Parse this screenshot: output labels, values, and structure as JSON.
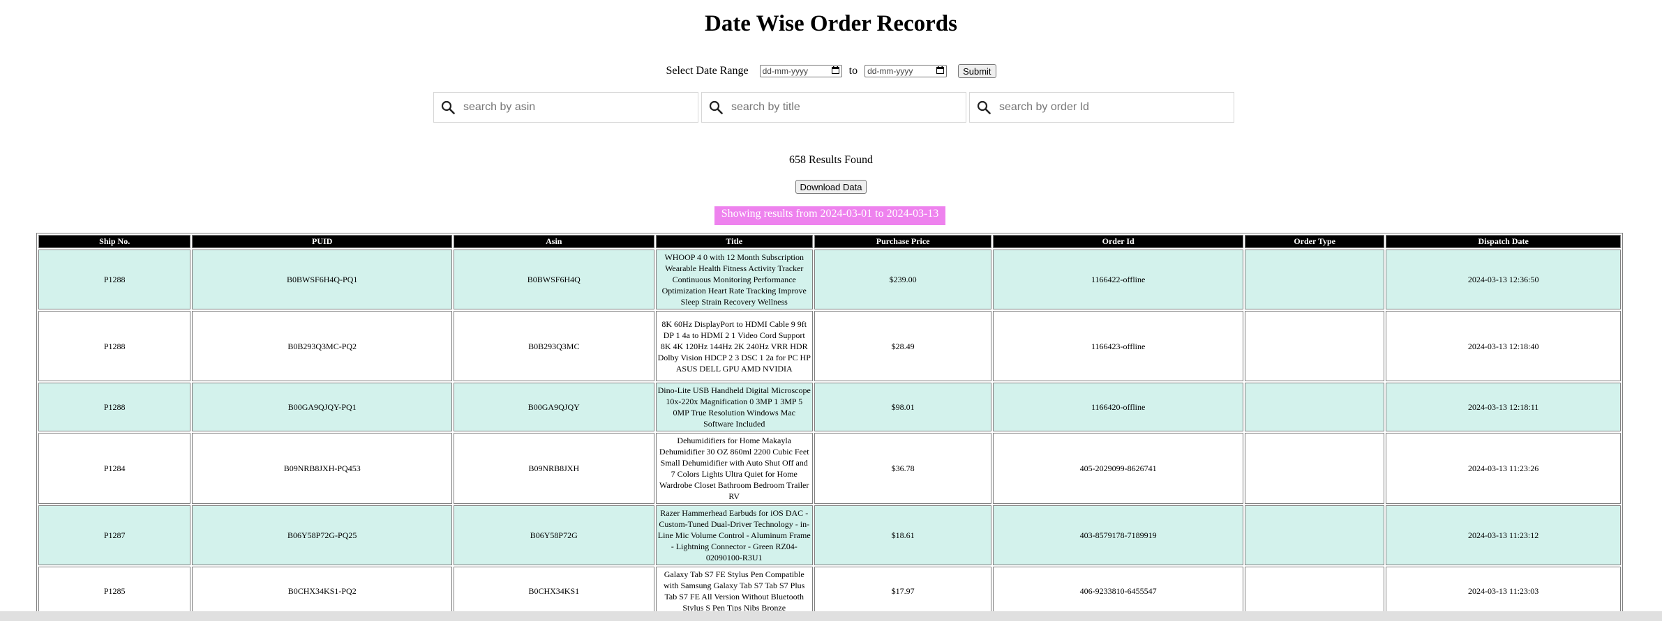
{
  "page": {
    "title": "Date Wise Order Records"
  },
  "date_filter": {
    "label": "Select Date Range",
    "from_placeholder": "dd-mm-yyyy",
    "to_label": "to",
    "to_placeholder": "dd-mm-yyyy",
    "submit_label": "Submit"
  },
  "search": {
    "asin_placeholder": "search by asin",
    "title_placeholder": "search by title",
    "order_placeholder": "search by order Id"
  },
  "results": {
    "count_text": "658 Results Found",
    "download_label": "Download Data",
    "range_text": "Showing results from 2024-03-01 to 2024-03-13"
  },
  "colors": {
    "badge": "#ee82ee",
    "row_alt": "#d3f2ec",
    "header_bg": "#000000"
  },
  "table": {
    "headers": [
      "Ship No.",
      "PUID",
      "Asin",
      "Title",
      "Purchase Price",
      "Order Id",
      "Order Type",
      "Dispatch Date"
    ],
    "rows": [
      {
        "ship": "P1288",
        "puid": "B0BWSF6H4Q-PQ1",
        "asin": "B0BWSF6H4Q",
        "title": "WHOOP 4 0 with 12 Month Subscription Wearable Health Fitness Activity Tracker Continuous Monitoring Performance Optimization Heart Rate Tracking Improve Sleep Strain Recovery Wellness",
        "price": "$239.00",
        "order_id": "1166422-offline",
        "order_type": "",
        "dispatch": "2024-03-13 12:36:50"
      },
      {
        "ship": "P1288",
        "puid": "B0B293Q3MC-PQ2",
        "asin": "B0B293Q3MC",
        "title": "8K 60Hz DisplayPort to HDMI Cable 9 9ft DP 1 4a to HDMI 2 1 Video Cord Support 8K 4K 120Hz 144Hz 2K 240Hz VRR HDR Dolby Vision HDCP 2 3 DSC 1 2a for PC HP ASUS DELL GPU AMD NVIDIA",
        "price": "$28.49",
        "order_id": "1166423-offline",
        "order_type": "",
        "dispatch": "2024-03-13 12:18:40"
      },
      {
        "ship": "P1288",
        "puid": "B00GA9QJQY-PQ1",
        "asin": "B00GA9QJQY",
        "title": "Dino-Lite USB Handheld Digital Microscope 10x-220x Magnification 0 3MP 1 3MP 5 0MP True Resolution Windows Mac Software Included",
        "price": "$98.01",
        "order_id": "1166420-offline",
        "order_type": "",
        "dispatch": "2024-03-13 12:18:11"
      },
      {
        "ship": "P1284",
        "puid": "B09NRB8JXH-PQ453",
        "asin": "B09NRB8JXH",
        "title": "Dehumidifiers for Home Makayla Dehumidifier 30 OZ 860ml 2200 Cubic Feet Small Dehumidifier with Auto Shut Off and 7 Colors Lights Ultra Quiet for Home Wardrobe Closet Bathroom Bedroom Trailer RV",
        "price": "$36.78",
        "order_id": "405-2029099-8626741",
        "order_type": "",
        "dispatch": "2024-03-13 11:23:26"
      },
      {
        "ship": "P1287",
        "puid": "B06Y58P72G-PQ25",
        "asin": "B06Y58P72G",
        "title": "Razer Hammerhead Earbuds for iOS DAC - Custom-Tuned Dual-Driver Technology - in-Line Mic Volume Control - Aluminum Frame - Lightning Connector - Green RZ04-02090100-R3U1",
        "price": "$18.61",
        "order_id": "403-8579178-7189919",
        "order_type": "",
        "dispatch": "2024-03-13 11:23:12"
      },
      {
        "ship": "P1285",
        "puid": "B0CHX34KS1-PQ2",
        "asin": "B0CHX34KS1",
        "title": "Galaxy Tab S7 FE Stylus Pen Compatible with Samsung Galaxy Tab S7 Tab S7 Plus Tab S7 FE All Version Without Bluetooth Stylus S Pen Tips Nibs Bronze",
        "price": "$17.97",
        "order_id": "406-9233810-6455547",
        "order_type": "",
        "dispatch": "2024-03-13 11:23:03"
      }
    ]
  }
}
